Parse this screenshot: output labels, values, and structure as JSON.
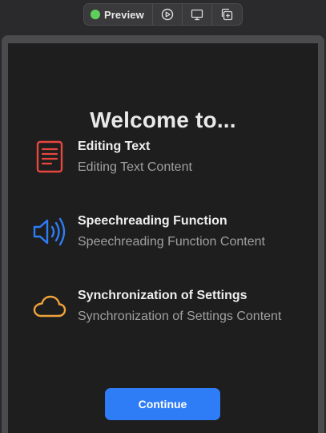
{
  "toolbar": {
    "preview_label": "Preview",
    "status_color": "#5fcf5b",
    "tools": [
      {
        "icon": "play-circle-icon"
      },
      {
        "icon": "monitor-icon"
      },
      {
        "icon": "duplicate-icon"
      }
    ]
  },
  "welcome": {
    "title": "Welcome to..."
  },
  "features": [
    {
      "title": "Editing Text",
      "subtitle": "Editing Text Content",
      "icon": "document-text-icon",
      "color": "#e5473f"
    },
    {
      "title": "Speechreading Function",
      "subtitle": "Speechreading Function Content",
      "icon": "speaker-wave-icon",
      "color": "#2e7cf6"
    },
    {
      "title": "Synchronization of Settings",
      "subtitle": "Synchronization of Settings Content",
      "icon": "cloud-icon",
      "color": "#f0a33a"
    }
  ],
  "actions": {
    "continue_label": "Continue",
    "continue_color": "#2e7cf6"
  }
}
